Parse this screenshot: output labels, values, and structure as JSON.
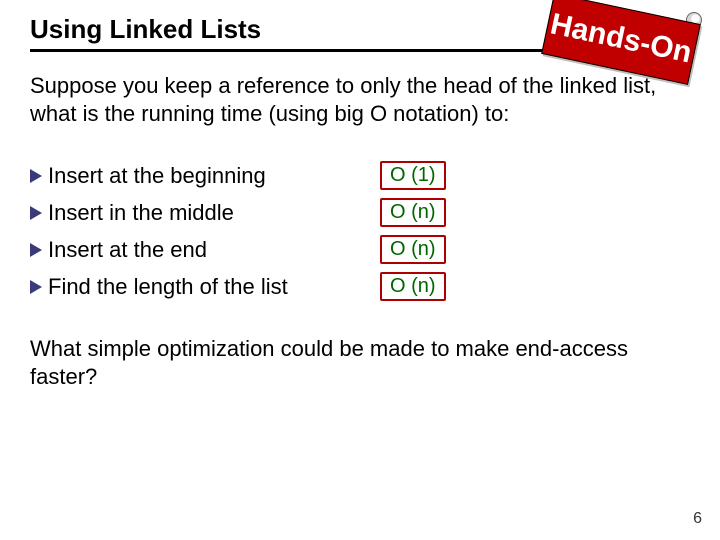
{
  "title": "Using Linked Lists",
  "badge": "Hands-On",
  "intro": "Suppose you keep a reference to only the head of the linked list, what is the running time (using big O notation) to:",
  "questions": [
    {
      "q": "Insert at the beginning",
      "a": "O (1)"
    },
    {
      "q": "Insert in the middle",
      "a": "O (n)"
    },
    {
      "q": "Insert at the end",
      "a": "O (n)"
    },
    {
      "q": "Find the length of the list",
      "a": "O (n)"
    }
  ],
  "followup": "What simple optimization could be made to make end-access faster?",
  "page_number": "6"
}
